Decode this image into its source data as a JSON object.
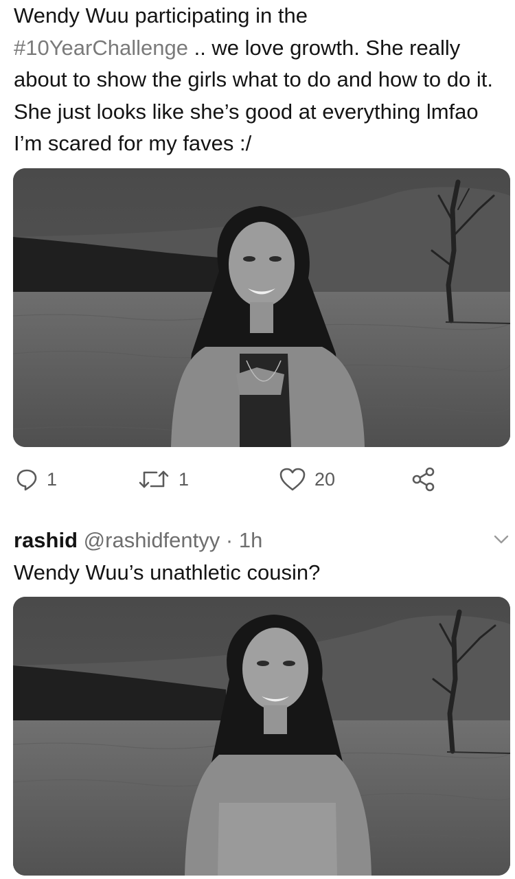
{
  "tweet": {
    "text_before_hashtag": "Wendy Wuu participating in the",
    "hashtag": "#10YearChallenge",
    "text_after_hashtag": " .. we love growth. She really about to show the girls what to do and how to do it. She just looks like she’s good at everything lmfao I’m scared for my faves :/",
    "actions": {
      "reply_icon": "reply-icon",
      "reply_count": "1",
      "retweet_icon": "retweet-icon",
      "retweet_count": "1",
      "like_icon": "heart-icon",
      "like_count": "20",
      "share_icon": "share-icon"
    }
  },
  "reply": {
    "name": "rashid",
    "handle": "@rashidfentyy",
    "time": "· 1h",
    "text": "Wendy Wuu’s unathletic cousin?",
    "menu_icon": "chevron-down-icon"
  }
}
